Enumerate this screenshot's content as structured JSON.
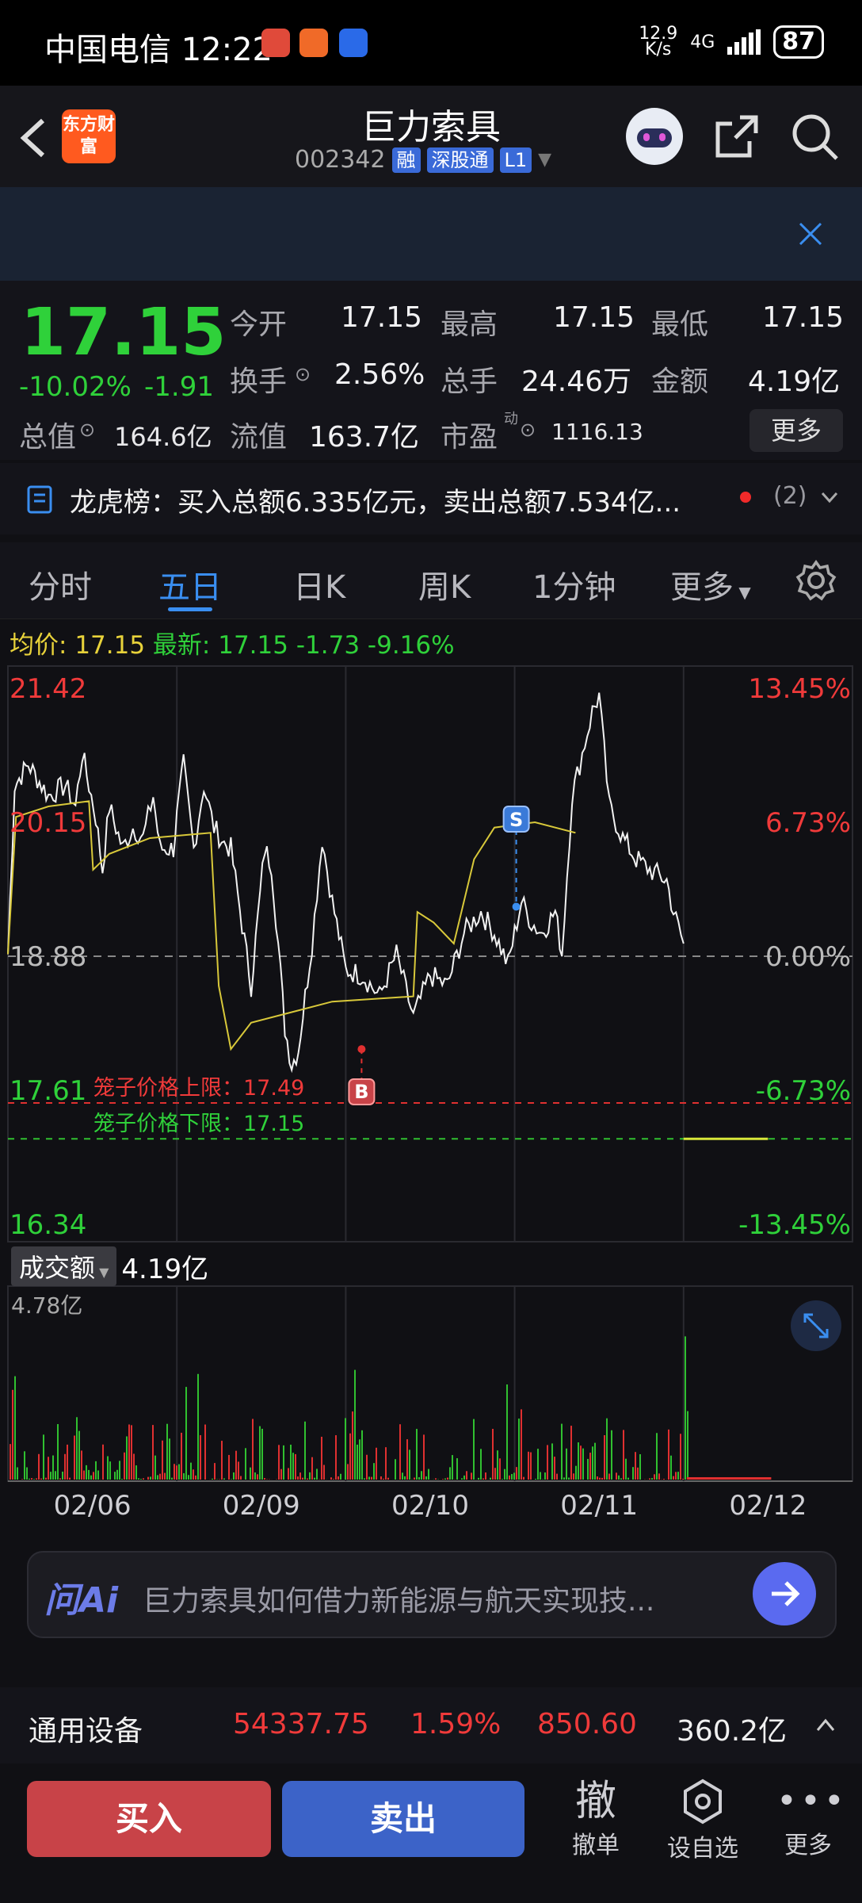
{
  "status_bar": {
    "carrier_time": "中国电信 12:22",
    "speed_top": "12.9",
    "speed_bottom": "K/s",
    "network": "4G",
    "battery": "87"
  },
  "header": {
    "logo": "东方财富",
    "stock_name": "巨力索具",
    "stock_code": "002342",
    "tags": [
      "融",
      "深股通",
      "L1"
    ]
  },
  "quote": {
    "price": "17.15",
    "change_pct": "-10.02%",
    "change": "-1.91",
    "open_label": "今开",
    "open": "17.15",
    "high_label": "最高",
    "high": "17.15",
    "low_label": "最低",
    "low": "17.15",
    "turnover_label": "换手",
    "turnover": "2.56%",
    "volume_label": "总手",
    "volume": "24.46万",
    "amount_label": "金额",
    "amount": "4.19亿",
    "mktcap_label": "总值",
    "mktcap": "164.6亿",
    "float_label": "流值",
    "float_cap": "163.7亿",
    "pe_label": "市盈",
    "pe_sup": "动",
    "pe": "1116.13",
    "more_label": "更多"
  },
  "lhb": {
    "text": "龙虎榜：买入总额6.335亿元，卖出总额7.534亿...",
    "count": "(2)"
  },
  "tabs": [
    "分时",
    "五日",
    "日K",
    "周K",
    "1分钟",
    "更多"
  ],
  "chart_info": {
    "avg_label": "均价:",
    "avg": "17.15",
    "latest_label": "最新:",
    "latest": "17.15",
    "chg": "-1.73",
    "chg_pct": "-9.16%"
  },
  "chart_data": {
    "type": "line",
    "y_left": [
      "21.42",
      "20.15",
      "18.88",
      "17.61",
      "16.34"
    ],
    "y_right": [
      "13.45%",
      "6.73%",
      "0.00%",
      "-6.73%",
      "-13.45%"
    ],
    "ylim": [
      16.34,
      21.42
    ],
    "baseline": 18.88,
    "x_labels": [
      "02/06",
      "02/09",
      "02/10",
      "02/11",
      "02/12"
    ],
    "upper_limit_label": "笼子价格上限：17.49",
    "lower_limit_label": "笼子价格下限：17.15",
    "markers": [
      "S",
      "B"
    ],
    "colors": {
      "price": "#f2f2f2",
      "avg": "#d8c83a",
      "up": "#e03030",
      "down": "#30c030"
    }
  },
  "volume": {
    "selector": "成交额",
    "value": "4.19亿",
    "max_label": "4.78亿"
  },
  "ai_bar": {
    "brand": "问Ai",
    "text": "巨力索具如何借力新能源与航天实现技..."
  },
  "sector": {
    "name": "通用设备",
    "index": "54337.75",
    "pct": "1.59%",
    "change": "850.60",
    "amount": "360.2亿"
  },
  "bottom": {
    "buy": "买入",
    "sell": "卖出",
    "cancel_glyph": "撤",
    "cancel": "撤单",
    "watch": "设自选",
    "more": "更多"
  }
}
